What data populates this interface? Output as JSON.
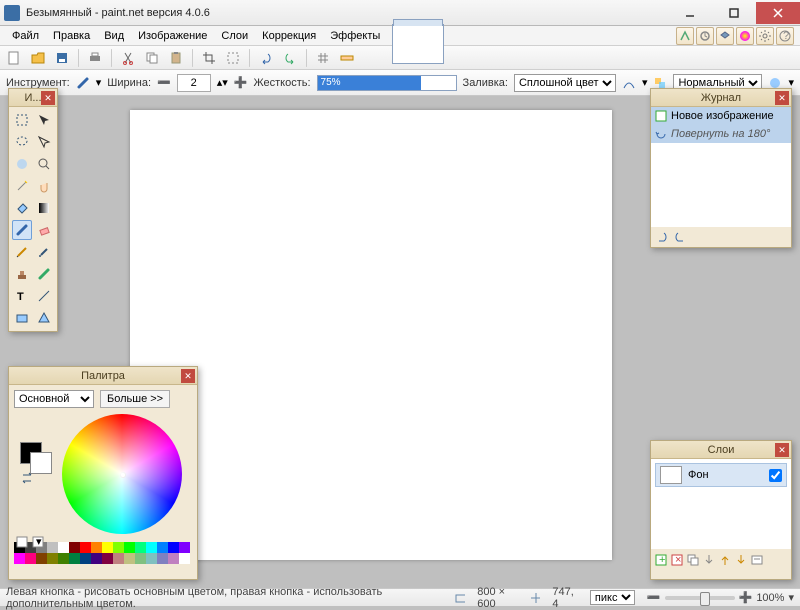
{
  "title": "Безымянный - paint.net версия 4.0.6",
  "menu": [
    "Файл",
    "Правка",
    "Вид",
    "Изображение",
    "Слои",
    "Коррекция",
    "Эффекты"
  ],
  "toolopts": {
    "instrument_label": "Инструмент:",
    "width_label": "Ширина:",
    "width_value": "2",
    "hardness_label": "Жесткость:",
    "hardness_value": "75%",
    "fill_label": "Заливка:",
    "fill_value": "Сплошной цвет",
    "blend_label": "Нормальный"
  },
  "panels": {
    "tools_title": "И...",
    "history_title": "Журнал",
    "layers_title": "Слои",
    "palette_title": "Палитра"
  },
  "history": {
    "items": [
      {
        "label": "Новое изображение"
      },
      {
        "label": "Повернуть на 180°"
      }
    ]
  },
  "layers": {
    "items": [
      {
        "label": "Фон",
        "visible": true
      }
    ]
  },
  "palette": {
    "mode": "Основной",
    "more": "Больше >>",
    "strip": [
      "#000",
      "#404040",
      "#808080",
      "#c0c0c0",
      "#fff",
      "#800000",
      "#f00",
      "#ff8000",
      "#ff0",
      "#80ff00",
      "#0f0",
      "#00ff80",
      "#0ff",
      "#0080ff",
      "#00f",
      "#8000ff",
      "#f0f",
      "#ff0080",
      "#804000",
      "#808000",
      "#408000",
      "#008040",
      "#004080",
      "#400080",
      "#800040",
      "#c08080",
      "#c0c080",
      "#80c080",
      "#80c0c0",
      "#8080c0",
      "#c080c0",
      "#ffffff"
    ]
  },
  "status": {
    "hint": "Левая кнопка - рисовать основным цветом, правая кнопка - использовать дополнительным цветом.",
    "dims": "800 × 600",
    "cursor": "747, 4",
    "units": "пикс",
    "zoom": "100%"
  }
}
